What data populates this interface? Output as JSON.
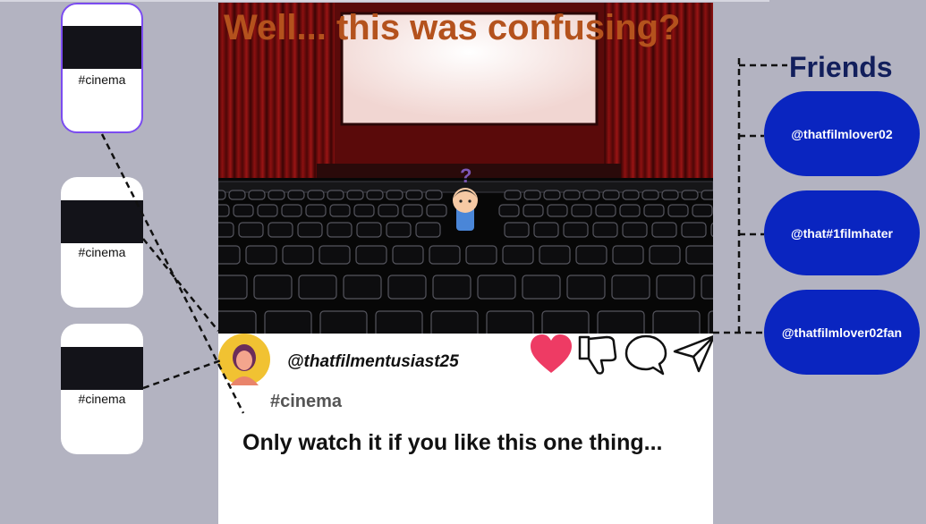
{
  "headline": "Well... this was confusing?",
  "post": {
    "username": "@thatfilmentusiast25",
    "hashtag": "#cinema",
    "caption": "Only watch it if you like this one thing..."
  },
  "thumbnails": [
    {
      "tag": "#cinema",
      "selected": true
    },
    {
      "tag": "#cinema",
      "selected": false
    },
    {
      "tag": "#cinema",
      "selected": false
    }
  ],
  "actions": {
    "like_color": "#ee3b64"
  },
  "friends": {
    "title": "Friends",
    "items": [
      {
        "handle": "@thatfilmlover02"
      },
      {
        "handle": "@that#1filmhater"
      },
      {
        "handle": "@thatfilmlover02fan"
      }
    ]
  },
  "colors": {
    "background": "#b3b3c1",
    "friend_pill": "#0a25c0",
    "headline": "#b4521d",
    "selected_border": "#7b4cf0"
  }
}
